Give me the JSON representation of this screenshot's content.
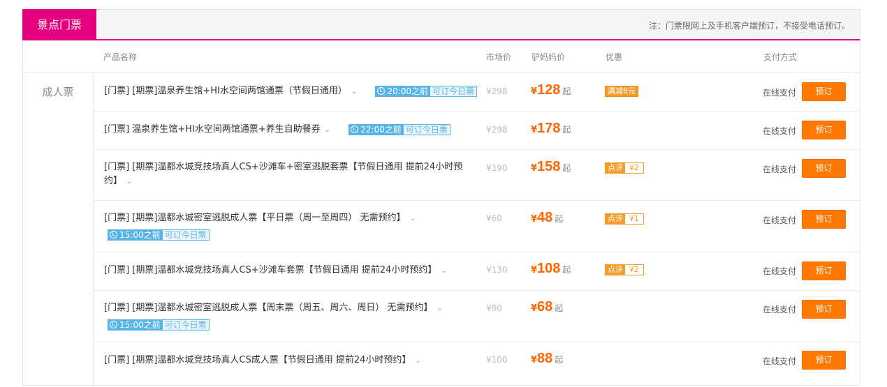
{
  "tab": {
    "label": "景点门票"
  },
  "note": "注：门票限网上及手机客户端预订，不接受电话预订。",
  "columns": {
    "name": "产品名称",
    "market": "市场价",
    "price": "驴妈妈价",
    "promo": "优惠",
    "pay": "支付方式"
  },
  "group": {
    "label": "成人票"
  },
  "colors": {
    "accent": "#e4007f",
    "orange": "#ff7800",
    "tag_blue": "#58b4e6"
  },
  "rows": [
    {
      "name": "[门票] [期票]温泉养生馆+HI水空间两馆通票（节假日通用）",
      "tag": {
        "time": "20:00之前",
        "text": "可订今日票"
      },
      "market": "¥298",
      "currency": "¥",
      "price": "128",
      "qi": "起",
      "promo": {
        "type": "full",
        "text": "满减8元"
      },
      "pay": "在线支付",
      "btn": "预订"
    },
    {
      "name": "[门票] 温泉养生馆+HI水空间两馆通票+养生自助餐券",
      "tag": {
        "time": "22:00之前",
        "text": "可订今日票"
      },
      "market": "¥298",
      "currency": "¥",
      "price": "178",
      "qi": "起",
      "pay": "在线支付",
      "btn": "预订"
    },
    {
      "name_line1": "[门票] [期票]温都水城竞技场真人CS+沙滩车+密室逃脱套票【节假日通用 提前24小时预",
      "name_line2": "约】",
      "market": "¥190",
      "currency": "¥",
      "price": "158",
      "qi": "起",
      "promo": {
        "type": "cmt",
        "label": "点评",
        "value": "¥2"
      },
      "pay": "在线支付",
      "btn": "预订"
    },
    {
      "name": "[门票] [期票]温都水城密室逃脱成人票【平日票（周一至周四） 无需预约】",
      "tag": {
        "time": "15:00之前",
        "text": "可订今日票"
      },
      "market": "¥60",
      "currency": "¥",
      "price": "48",
      "qi": "起",
      "promo": {
        "type": "cmt",
        "label": "点评",
        "value": "¥1"
      },
      "pay": "在线支付",
      "btn": "预订"
    },
    {
      "name": "[门票] [期票]温都水城竞技场真人CS+沙滩车套票【节假日通用 提前24小时预约】",
      "market": "¥130",
      "currency": "¥",
      "price": "108",
      "qi": "起",
      "promo": {
        "type": "cmt",
        "label": "点评",
        "value": "¥2"
      },
      "pay": "在线支付",
      "btn": "预订"
    },
    {
      "name": "[门票] [期票]温都水城密室逃脱成人票【周末票（周五、周六、周日） 无需预约】",
      "tag": {
        "time": "15:00之前",
        "text": "可订今日票"
      },
      "market": "¥80",
      "currency": "¥",
      "price": "68",
      "qi": "起",
      "pay": "在线支付",
      "btn": "预订"
    },
    {
      "name": "[门票] [期票]温都水城竞技场真人CS成人票【节假日通用 提前24小时预约】",
      "market": "¥100",
      "currency": "¥",
      "price": "88",
      "qi": "起",
      "pay": "在线支付",
      "btn": "预订"
    }
  ]
}
